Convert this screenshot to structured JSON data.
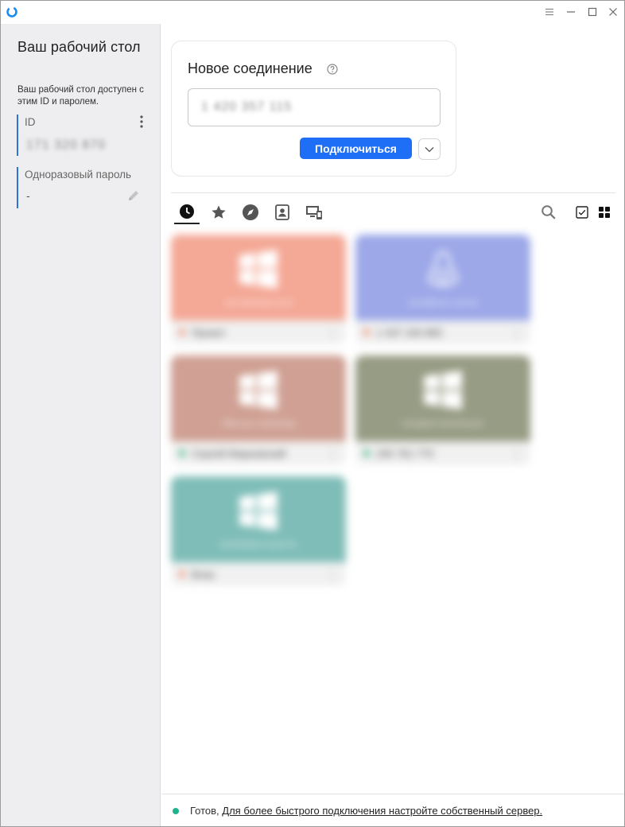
{
  "window": {
    "icons": {
      "app": "app-logo-icon",
      "menu": "hamburger-menu-icon",
      "minimize": "minimize-icon",
      "maximize": "maximize-icon",
      "close": "close-icon"
    }
  },
  "sidebar": {
    "title": "Ваш рабочий стол",
    "description": "Ваш рабочий стол доступен с этим ID и паролем.",
    "id_label": "ID",
    "id_value": "171 320 870",
    "password_label": "Одноразовый пароль",
    "password_value": "-"
  },
  "connection": {
    "title": "Новое соединение",
    "input_value": "1 420 357 115",
    "connect_label": "Подключиться"
  },
  "tabs": [
    {
      "name": "recent",
      "icon": "clock-icon",
      "active": true
    },
    {
      "name": "favorites",
      "icon": "star-icon",
      "active": false
    },
    {
      "name": "discovered",
      "icon": "compass-icon",
      "active": false
    },
    {
      "name": "address-book",
      "icon": "address-book-icon",
      "active": false
    },
    {
      "name": "devices",
      "icon": "devices-icon",
      "active": false
    }
  ],
  "tools": {
    "search": "search-icon",
    "select": "checkbox-icon",
    "view": "grid-view-icon"
  },
  "peers": [
    {
      "name": "Проект",
      "caption": "win-desktop-local",
      "color": "#f4a896",
      "os": "windows",
      "dot": "#ee8a6a"
    },
    {
      "name": "1 437 230 883",
      "caption": "user@linux-server",
      "color": "#9ca8e8",
      "os": "linux",
      "dot": "#ee8a6a"
    },
    {
      "name": "Сергей Марковский",
      "caption": "office-pc-marketing",
      "color": "#cfa093",
      "os": "windows",
      "dot": "#36b07a"
    },
    {
      "name": "245 761 770",
      "caption": "reception-terminal-pc",
      "color": "#979c84",
      "os": "windows",
      "dot": "#36b07a"
    },
    {
      "name": "Влас",
      "caption": "workstation-local-01",
      "color": "#7fbdb8",
      "os": "windows",
      "dot": "#ee8a6a"
    }
  ],
  "status": {
    "ready": "Готов,",
    "link": "Для более быстрого подключения настройте собственный сервер.",
    "color": "#20b28c"
  },
  "colors": {
    "accent": "#1e6ff5",
    "sidebar_accent": "#2e74d8",
    "sidebar_bg": "#eeeef0"
  }
}
